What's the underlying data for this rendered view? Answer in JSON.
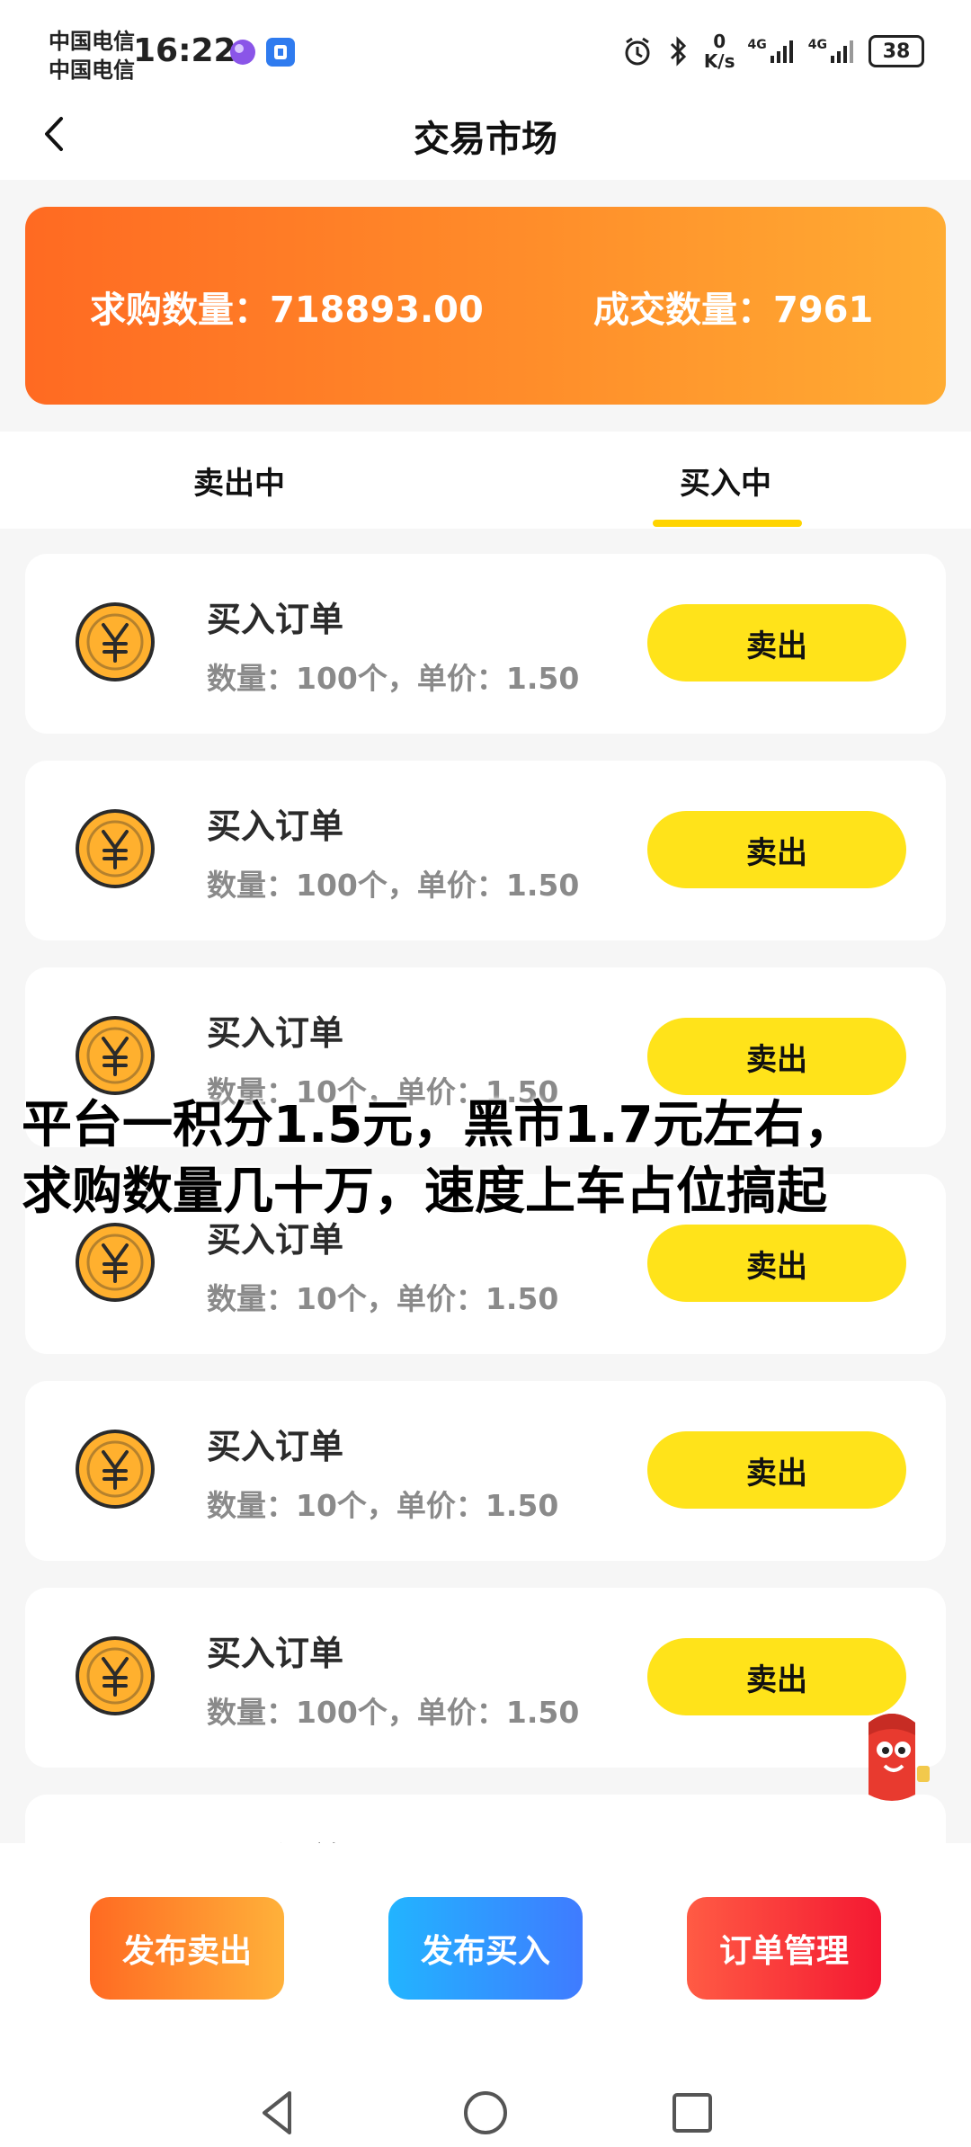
{
  "status_bar": {
    "carrier1": "中国电信",
    "carrier2": "中国电信",
    "time": "16:22",
    "net_speed_value": "0",
    "net_speed_unit": "K/s",
    "net1": "4G",
    "net2": "4G",
    "battery": "38"
  },
  "header": {
    "title": "交易市场",
    "back_icon": "chevron-left-icon"
  },
  "stats": {
    "want_label": "求购数量：718893.00",
    "deal_label": "成交数量：7961"
  },
  "tabs": [
    {
      "label": "卖出中",
      "active": false
    },
    {
      "label": "买入中",
      "active": true
    }
  ],
  "orders": [
    {
      "title": "买入订单",
      "detail": "数量：100个，单价：1.50",
      "action": "卖出"
    },
    {
      "title": "买入订单",
      "detail": "数量：100个，单价：1.50",
      "action": "卖出"
    },
    {
      "title": "买入订单",
      "detail": "数量：10个，单价：1.50",
      "action": "卖出"
    },
    {
      "title": "买入订单",
      "detail": "数量：10个，单价：1.50",
      "action": "卖出"
    },
    {
      "title": "买入订单",
      "detail": "数量：10个，单价：1.50",
      "action": "卖出"
    },
    {
      "title": "买入订单",
      "detail": "数量：100个，单价：1.50",
      "action": "卖出"
    },
    {
      "title": "买入订单",
      "detail": "",
      "action": ""
    }
  ],
  "overlay_text": {
    "line1": "平台一积分1.5元，黑市1.7元左右，",
    "line2": "求购数量几十万，速度上车占位搞起"
  },
  "actions": {
    "publish_sell": "发布卖出",
    "publish_buy": "发布买入",
    "order_manage": "订单管理"
  },
  "colors": {
    "orange_start": "#ff6a22",
    "orange_end": "#ffac33",
    "yellow": "#ffe31a",
    "blue": "#3f7bff",
    "red": "#f41832"
  }
}
